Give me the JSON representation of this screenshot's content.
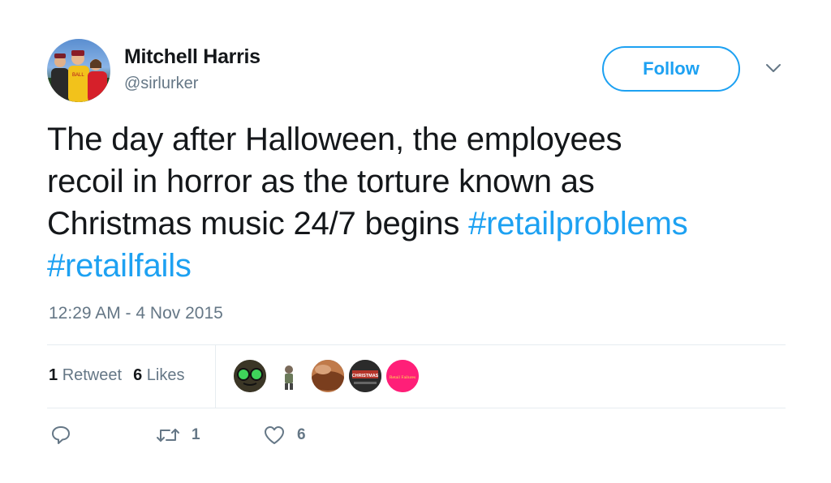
{
  "author": {
    "name": "Mitchell Harris",
    "handle": "@sirlurker"
  },
  "follow_label": "Follow",
  "tweet": {
    "text_lines": [
      "The day after Halloween, the employees",
      "recoil in horror as the torture known as",
      "Christmas music 24/7 begins "
    ],
    "hashtags": [
      "#retailproblems",
      "#retailfails"
    ],
    "timestamp": "12:29 AM - 4 Nov 2015"
  },
  "stats": {
    "retweets_count": "1",
    "retweets_label": "Retweet",
    "likes_count": "6",
    "likes_label": "Likes"
  },
  "liker_avatars": [
    {
      "icon": "frog-goggles-avatar",
      "color": "#3a3a2a"
    },
    {
      "icon": "cartoon-character-avatar",
      "color": "#ffffff"
    },
    {
      "icon": "landscape-photo-avatar",
      "color": "#8b5a3c"
    },
    {
      "icon": "christmas-text-avatar",
      "color": "#2a2a2a",
      "text": "CHRISTMAS"
    },
    {
      "icon": "retail-logo-avatar",
      "color": "#ff1f78",
      "text": "Retail Failures"
    }
  ],
  "actions": {
    "reply_count": "",
    "retweet_count": "1",
    "like_count": "6"
  },
  "colors": {
    "accent": "#1da1f2",
    "secondary_text": "#657786",
    "primary_text": "#14171a",
    "divider": "#e6ecf0"
  }
}
